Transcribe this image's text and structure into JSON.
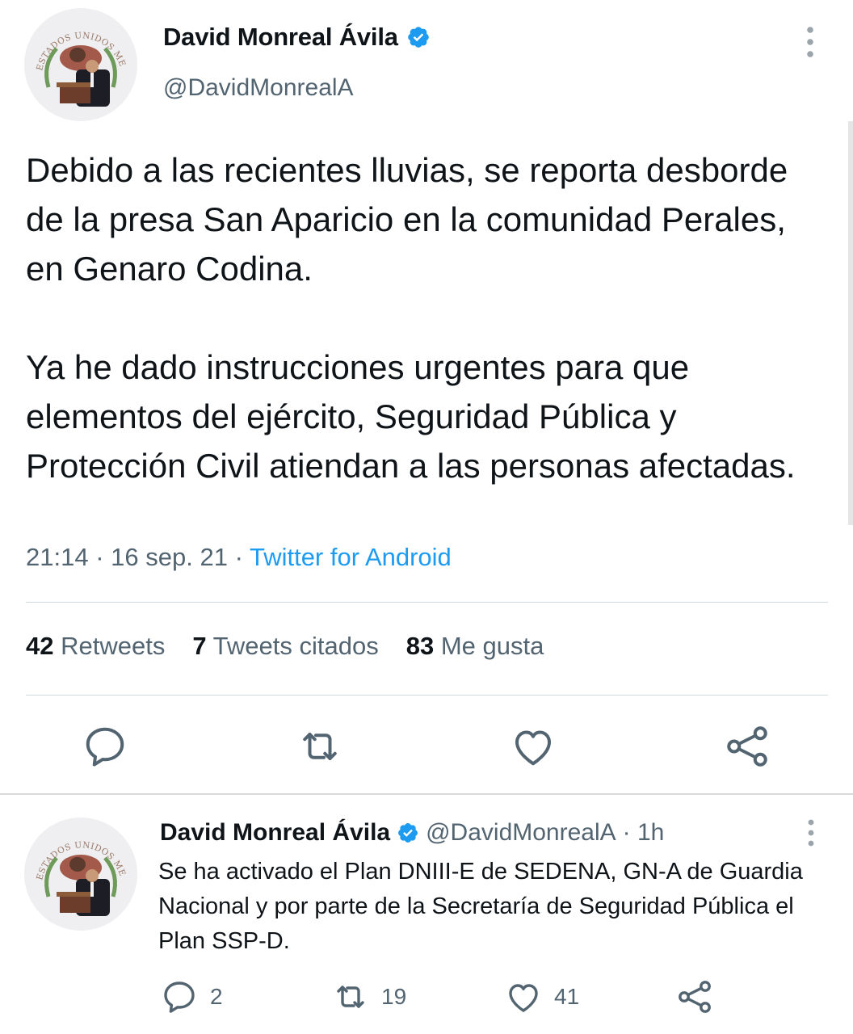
{
  "main_tweet": {
    "author_name": "David Monreal Ávila",
    "handle": "@DavidMonrealA",
    "avatar_seal_text": "ESTADOS UNIDOS MEXICANOS",
    "text": "Debido a las recientes lluvias, se reporta desborde de la presa San Aparicio en la comunidad Perales, en Genaro Codina.\n\nYa he dado instrucciones urgentes para que elementos del ejército, Seguridad Pública y Protección Civil atiendan a las personas afectadas.",
    "time": "21:14",
    "date": "16 sep. 21",
    "separator": "·",
    "source": "Twitter for Android",
    "stats": {
      "retweets_count": "42",
      "retweets_label": "Retweets",
      "quotes_count": "7",
      "quotes_label": "Tweets citados",
      "likes_count": "83",
      "likes_label": "Me gusta"
    }
  },
  "reply_tweet": {
    "author_name": "David Monreal Ávila",
    "handle": "@DavidMonrealA",
    "time_ago": "· 1h",
    "text": "Se ha activado el Plan DNIII-E  de SEDENA, GN-A de Guardia Nacional y por parte de la Secretaría de Seguridad Pública el Plan SSP-D.",
    "replies": "2",
    "retweets": "19",
    "likes": "41"
  },
  "colors": {
    "text": "#0f1419",
    "secondary": "#536471",
    "link": "#1d9bf0",
    "verified": "#1d9bf0",
    "divider": "#cfd9de"
  }
}
